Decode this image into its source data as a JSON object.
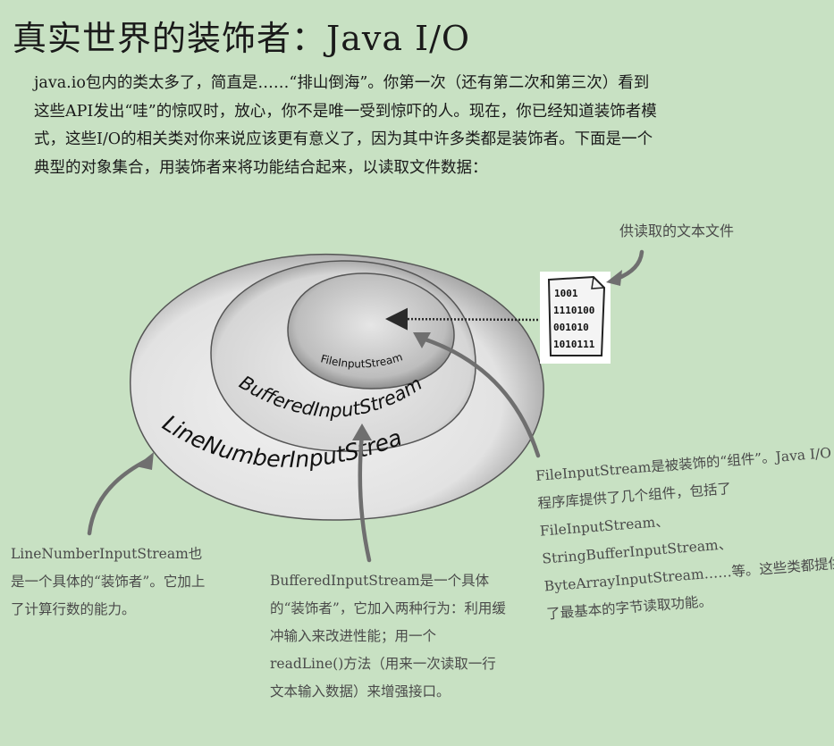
{
  "title": "真实世界的装饰者：Java I/O",
  "intro": "java.io包内的类太多了，简直是……“排山倒海”。你第一次（还有第二次和第三次）看到这些API发出“哇”的惊叹时，放心，你不是唯一受到惊吓的人。现在，你已经知道装饰者模式，这些I/O的相关类对你来说应该更有意义了，因为其中许多类都是装饰者。下面是一个典型的对象集合，用装饰者来将功能结合起来，以读取文件数据：",
  "diagram": {
    "outer_label": "LineNumberInputStream",
    "middle_label": "BufferedInputStream",
    "inner_label": "FileInputStream",
    "file_lines": [
      "1001",
      "1110100",
      "001010",
      "1010111"
    ]
  },
  "notes": {
    "file": "供读取的文本文件",
    "line_number": "LineNumberInputStream也是一个具体的“装饰者”。它加上了计算行数的能力。",
    "buffered": "BufferedInputStream是一个具体的“装饰者”，它加入两种行为：利用缓冲输入来改进性能；用一个readLine()方法（用来一次读取一行文本输入数据）来增强接口。",
    "file_input": "FileInputStream是被装饰的“组件”。Java I/O程序库提供了几个组件，包括了FileInputStream、StringBufferInputStream、ByteArrayInputStream……等。这些类都提供了最基本的字节读取功能。"
  },
  "colors": {
    "background": "#c8e1c3",
    "outer_ring": "#e6e6e6",
    "middle_ring": "#dadada",
    "inner_core": "#c9c9c9",
    "arrow": "#6f6f6f"
  }
}
